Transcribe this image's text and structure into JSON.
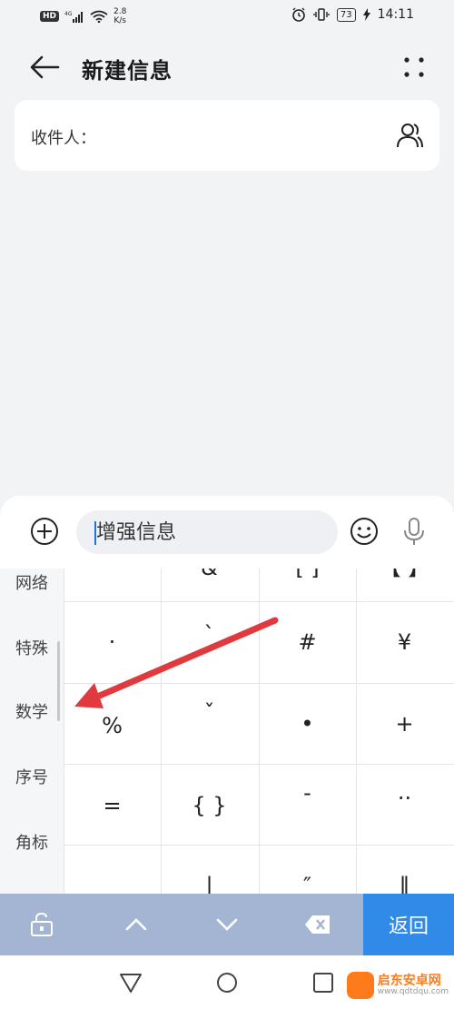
{
  "status_bar": {
    "hd": "HD",
    "net_speed_value": "2.8",
    "net_speed_unit": "K/s",
    "battery": "73",
    "time": "14:11"
  },
  "header": {
    "title": "新建信息"
  },
  "recipient": {
    "label": "收件人："
  },
  "compose": {
    "placeholder": "增强信息"
  },
  "keyboard": {
    "categories": [
      "网络",
      "特殊",
      "数学",
      "序号",
      "角标"
    ],
    "symbols_row1": [
      "·",
      "`",
      "#",
      "¥"
    ],
    "symbols_row2": [
      "%",
      "ˇ",
      "•",
      "+"
    ],
    "symbols_row3": [
      "=",
      "{ }",
      "-",
      "··"
    ],
    "symbols_row4": [
      "",
      "|",
      "″",
      "‖"
    ]
  },
  "toolbar": {
    "return_label": "返回"
  },
  "watermark": {
    "brand": "启东安卓网",
    "url": "www.qdtdqu.com"
  },
  "colors": {
    "accent": "#2f8ae8",
    "toolbar": "#a3b5d3",
    "annotation": "#e0393e"
  }
}
